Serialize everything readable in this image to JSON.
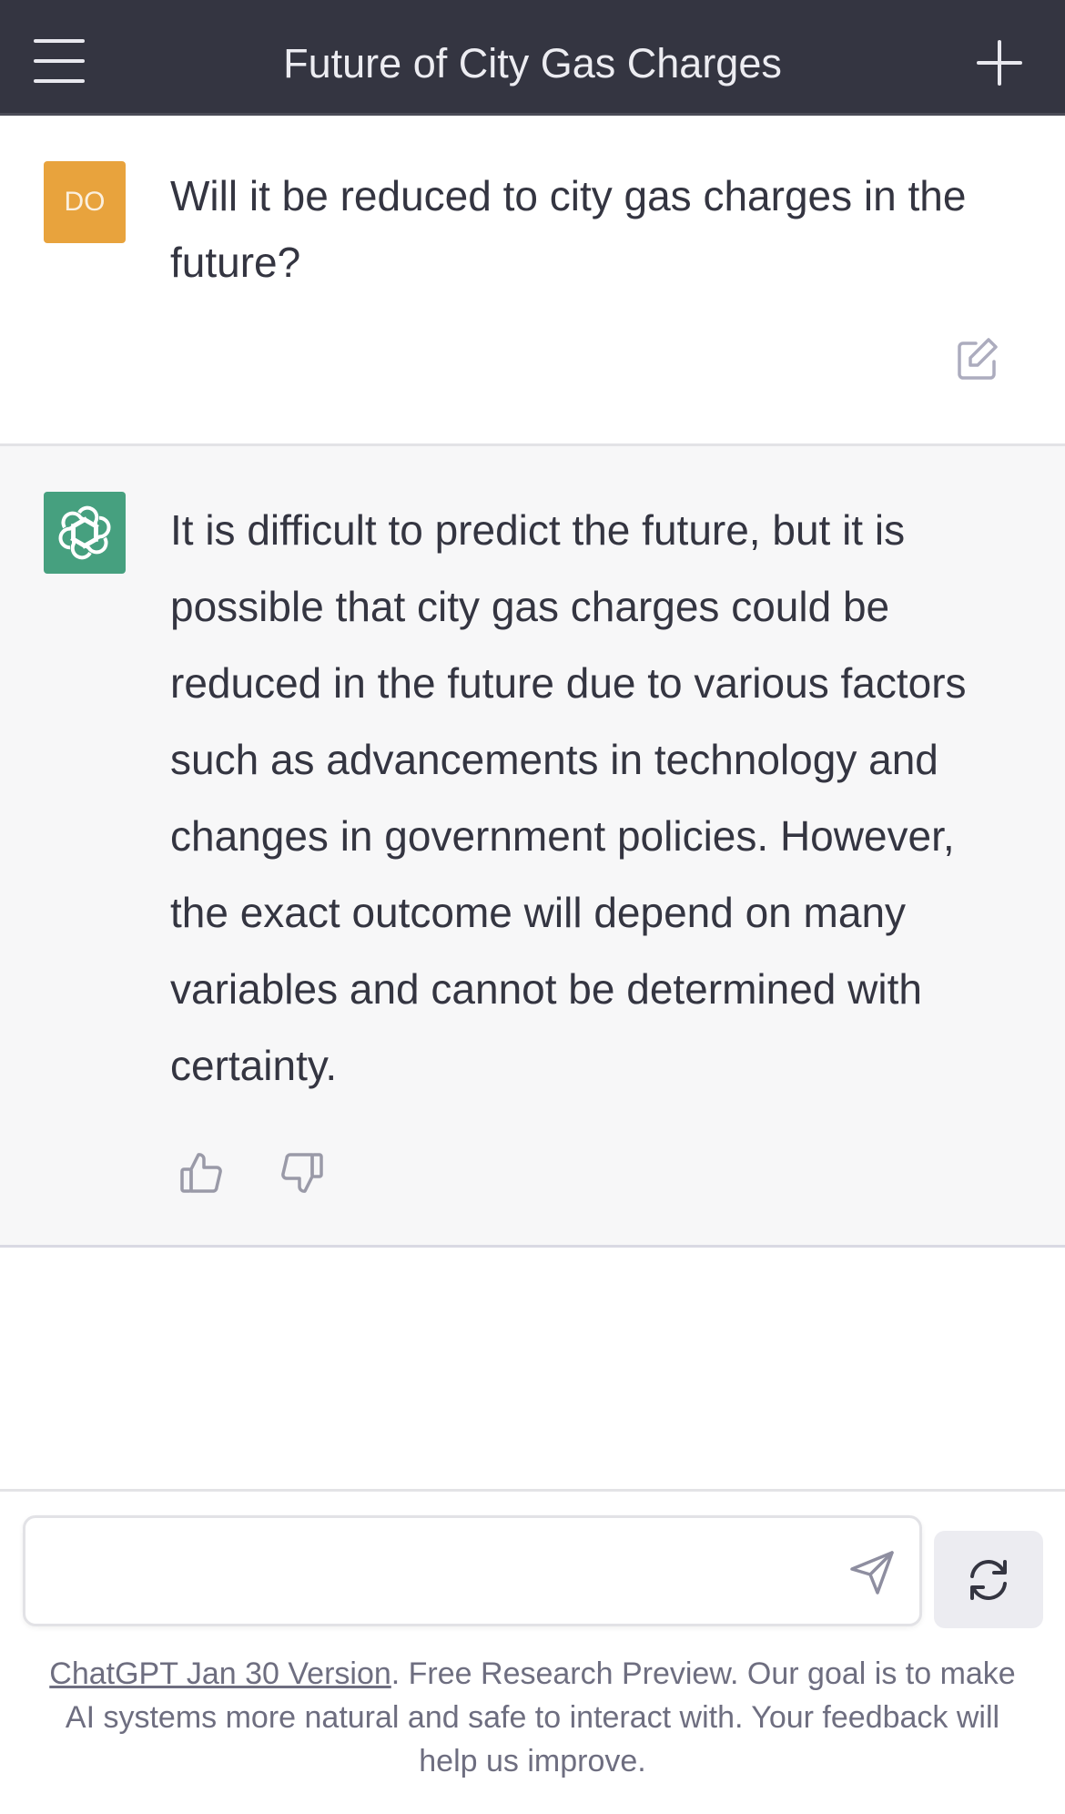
{
  "header": {
    "title": "Future of City Gas Charges",
    "menu_icon": "hamburger-menu-icon",
    "new_chat_icon": "plus-icon",
    "background_color": "#343541"
  },
  "conversation": {
    "user_message": {
      "avatar_initials": "DO",
      "avatar_color": "#e8a33d",
      "text": "Will it be reduced to city gas charges in the future?",
      "edit_icon": "edit-icon"
    },
    "assistant_message": {
      "avatar_icon": "openai-logo-icon",
      "avatar_color": "#46a07f",
      "text": "It is difficult to predict the future, but it is possible that city gas charges could be reduced in the future due to various factors such as advancements in technology and changes in government policies. However, the exact outcome will depend on many variables and cannot be determined with certainty.",
      "feedback_icons": [
        "thumbs-up-icon",
        "thumbs-down-icon"
      ]
    }
  },
  "composer": {
    "input_value": "",
    "send_icon": "send-icon",
    "regenerate_icon": "refresh-icon"
  },
  "footer": {
    "link_text": "ChatGPT Jan 30 Version",
    "text": ". Free Research Preview. Our goal is to make AI systems more natural and safe to interact with. Your feedback will help us improve."
  }
}
